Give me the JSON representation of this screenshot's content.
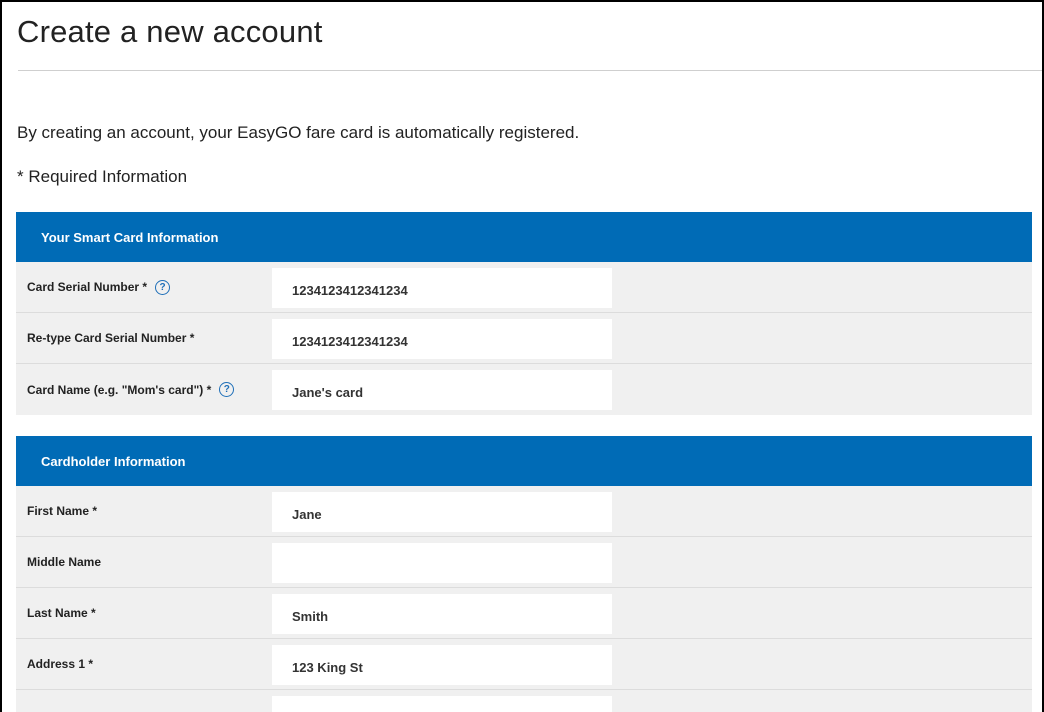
{
  "page": {
    "title": "Create a new account",
    "intro": "By creating an account, your EasyGO fare card is automatically registered.",
    "required_note": "* Required Information"
  },
  "colors": {
    "section_header_bg": "#006bb6",
    "row_bg": "#f0f0f0",
    "help_icon": "#1f6fb8"
  },
  "smart_card": {
    "header": "Your Smart Card Information",
    "fields": [
      {
        "label": "Card Serial Number *",
        "value": "1234123412341234",
        "help_icon": "question-circle-icon"
      },
      {
        "label": "Re-type Card Serial Number *",
        "value": "1234123412341234"
      },
      {
        "label": "Card Name (e.g. \"Mom's card\") *",
        "value": "Jane's card",
        "help_icon": "question-circle-icon"
      }
    ]
  },
  "cardholder": {
    "header": "Cardholder Information",
    "fields": [
      {
        "label": "First Name *",
        "value": "Jane"
      },
      {
        "label": "Middle Name",
        "value": ""
      },
      {
        "label": "Last Name *",
        "value": "Smith"
      },
      {
        "label": "Address 1 *",
        "value": "123 King St"
      },
      {
        "label": "",
        "value": ""
      }
    ]
  },
  "icons": {
    "help_glyph": "?"
  }
}
